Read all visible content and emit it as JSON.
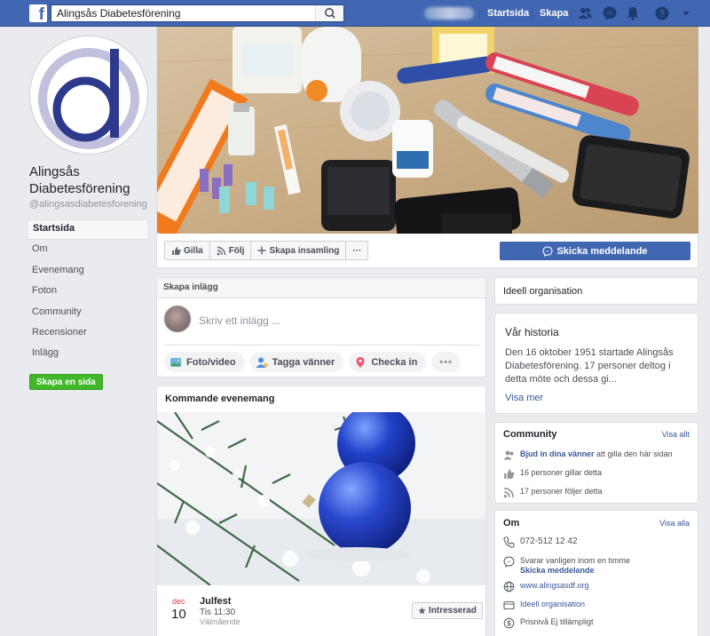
{
  "topbar": {
    "search_value": "Alingsås Diabetesförening",
    "nav": {
      "home": "Startsida",
      "create": "Skapa"
    },
    "icons": [
      "search-icon",
      "friends-icon",
      "messenger-icon",
      "bell-icon",
      "help-icon",
      "caret-down-icon"
    ]
  },
  "page": {
    "name": "Alingsås Diabetesförening",
    "handle": "@alingsasdiabetesforening"
  },
  "left_nav": [
    "Startsida",
    "Om",
    "Evenemang",
    "Foton",
    "Community",
    "Recensioner",
    "Inlägg"
  ],
  "create_page_label": "Skapa en sida",
  "actions": {
    "like": "Gilla",
    "follow": "Följ",
    "fundraiser": "Skapa insamling",
    "more": "···",
    "send_message": "Skicka meddelande"
  },
  "composer": {
    "header": "Skapa inlägg",
    "placeholder": "Skriv ett inlägg ...",
    "photo": "Foto/video",
    "tag": "Tagga vänner",
    "checkin": "Checka in",
    "more": "•••"
  },
  "events": {
    "title": "Kommande evenemang",
    "month": "dec",
    "day": "10",
    "name": "Julfest",
    "time": "Tis 11:30",
    "place": "Välmående",
    "interested": "Intresserad"
  },
  "right": {
    "category": "Ideell organisation",
    "history_title": "Vår historia",
    "history_text": "Den 16 oktober 1951 startade Alingsås Diabetesförening. 17 personer deltog i detta möte och dessa gi...",
    "history_more": "Visa mer",
    "community_title": "Community",
    "community_all": "Visa allt",
    "invite_link": "Bjud in dina vänner",
    "invite_rest": "att gilla den här sidan",
    "likes": "16 personer gillar detta",
    "follows": "17 personer följer detta",
    "about_title": "Om",
    "about_all": "Visa alla",
    "phone": "072-512 12 42",
    "response": "Svarar vanligen inom en timme",
    "response_link": "Skicka meddelande",
    "website": "www.alingsasdf.org",
    "category_link": "Ideell organisation",
    "price": "Prisnivå Ej tillämpligt"
  },
  "colors": {
    "brand": "#4267b2",
    "green": "#42b72a",
    "link": "#385898",
    "date_red": "#e3324b"
  }
}
